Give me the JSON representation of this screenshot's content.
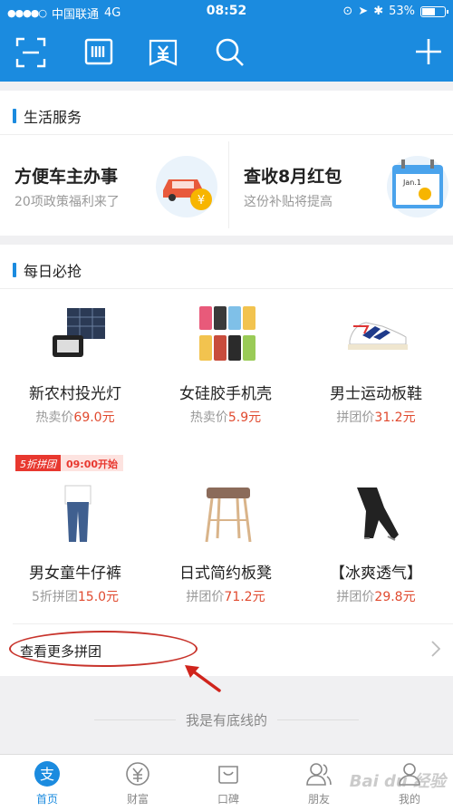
{
  "status_bar": {
    "carrier": "中国联通",
    "network": "4G",
    "time": "08:52",
    "battery": "53%"
  },
  "top_icons": [
    "scan-icon",
    "pay-code-icon",
    "card-icon",
    "search-icon",
    "add-icon"
  ],
  "life_service": {
    "title": "生活服务",
    "items": [
      {
        "title": "方便车主办事",
        "subtitle": "20项政策福利来了",
        "icon": "car-icon"
      },
      {
        "title": "查收8月红包",
        "subtitle": "这份补贴将提高",
        "icon": "calendar-icon"
      }
    ]
  },
  "daily": {
    "title": "每日必抢",
    "badge_label": "5折拼团",
    "badge_time": "09:00开始",
    "products": [
      {
        "name": "新农村投光灯",
        "price_label": "热卖价",
        "price": "69.0元"
      },
      {
        "name": "女硅胶手机壳",
        "price_label": "热卖价",
        "price": "5.9元"
      },
      {
        "name": "男士运动板鞋",
        "price_label": "拼团价",
        "price": "31.2元"
      },
      {
        "name": "男女童牛仔裤",
        "price_label": "5折拼团",
        "price": "15.0元"
      },
      {
        "name": "日式简约板凳",
        "price_label": "拼团价",
        "price": "71.2元"
      },
      {
        "name": "【冰爽透气】",
        "price_label": "拼团价",
        "price": "29.8元"
      }
    ],
    "more_label": "查看更多拼团"
  },
  "bottom_text": "我是有底线的",
  "tabs": [
    {
      "label": "首页",
      "icon": "alipay-icon"
    },
    {
      "label": "财富",
      "icon": "yen-icon"
    },
    {
      "label": "口碑",
      "icon": "smile-bag-icon"
    },
    {
      "label": "朋友",
      "icon": "friends-icon"
    },
    {
      "label": "我的",
      "icon": "profile-icon"
    }
  ],
  "watermark": "Bai du 经验",
  "colors": {
    "brand": "#1b8bdf",
    "price": "#e04a2f",
    "annotation": "#c8342c"
  }
}
